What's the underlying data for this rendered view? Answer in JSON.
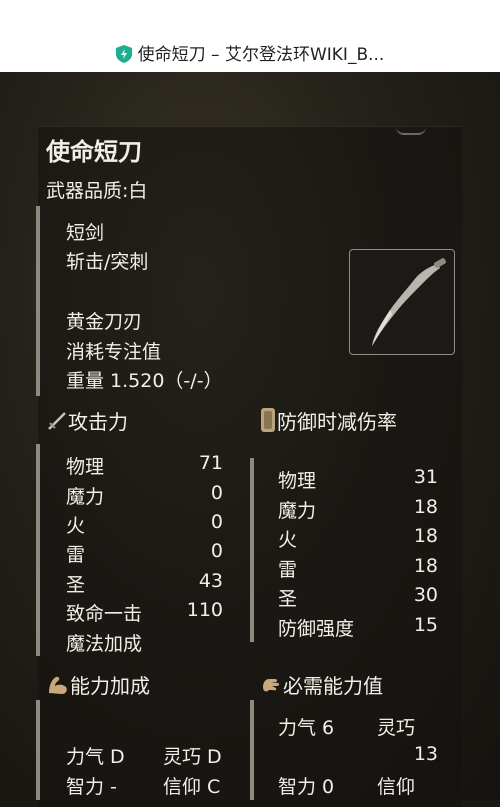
{
  "browser": {
    "title": "使命短刀 – 艾尔登法环WIKI_B..."
  },
  "weapon": {
    "name": "使命短刀",
    "quality": "武器品质:白",
    "type": "短剑",
    "attack_type": "斩击/突刺",
    "skill": "黄金刀刃",
    "cost": "消耗专注值",
    "weight": "重量 1.520（-/-）"
  },
  "attack": {
    "heading": "攻击力",
    "rows": [
      {
        "label": "物理",
        "value": "71"
      },
      {
        "label": "魔力",
        "value": "0"
      },
      {
        "label": "火",
        "value": "0"
      },
      {
        "label": "雷",
        "value": "0"
      },
      {
        "label": "圣",
        "value": "43"
      },
      {
        "label": "致命一击",
        "value": "110"
      },
      {
        "label": "魔法加成",
        "value": ""
      }
    ]
  },
  "defense": {
    "heading": "防御时减伤率",
    "rows": [
      {
        "label": "物理",
        "value": "31"
      },
      {
        "label": "魔力",
        "value": "18"
      },
      {
        "label": "火",
        "value": "18"
      },
      {
        "label": "雷",
        "value": "18"
      },
      {
        "label": "圣",
        "value": "30"
      },
      {
        "label": "防御强度",
        "value": "15"
      }
    ]
  },
  "scaling": {
    "heading": "能力加成",
    "row1": {
      "a": "力气 D",
      "b": "灵巧 D"
    },
    "row2": {
      "a": "智力 -",
      "b": "信仰 C"
    }
  },
  "requirements": {
    "heading": "必需能力值",
    "row1_a": "力气 6",
    "row1_b": "灵巧",
    "row1_b_value": "13",
    "row2_a": "智力 0",
    "row2_b": "信仰"
  }
}
